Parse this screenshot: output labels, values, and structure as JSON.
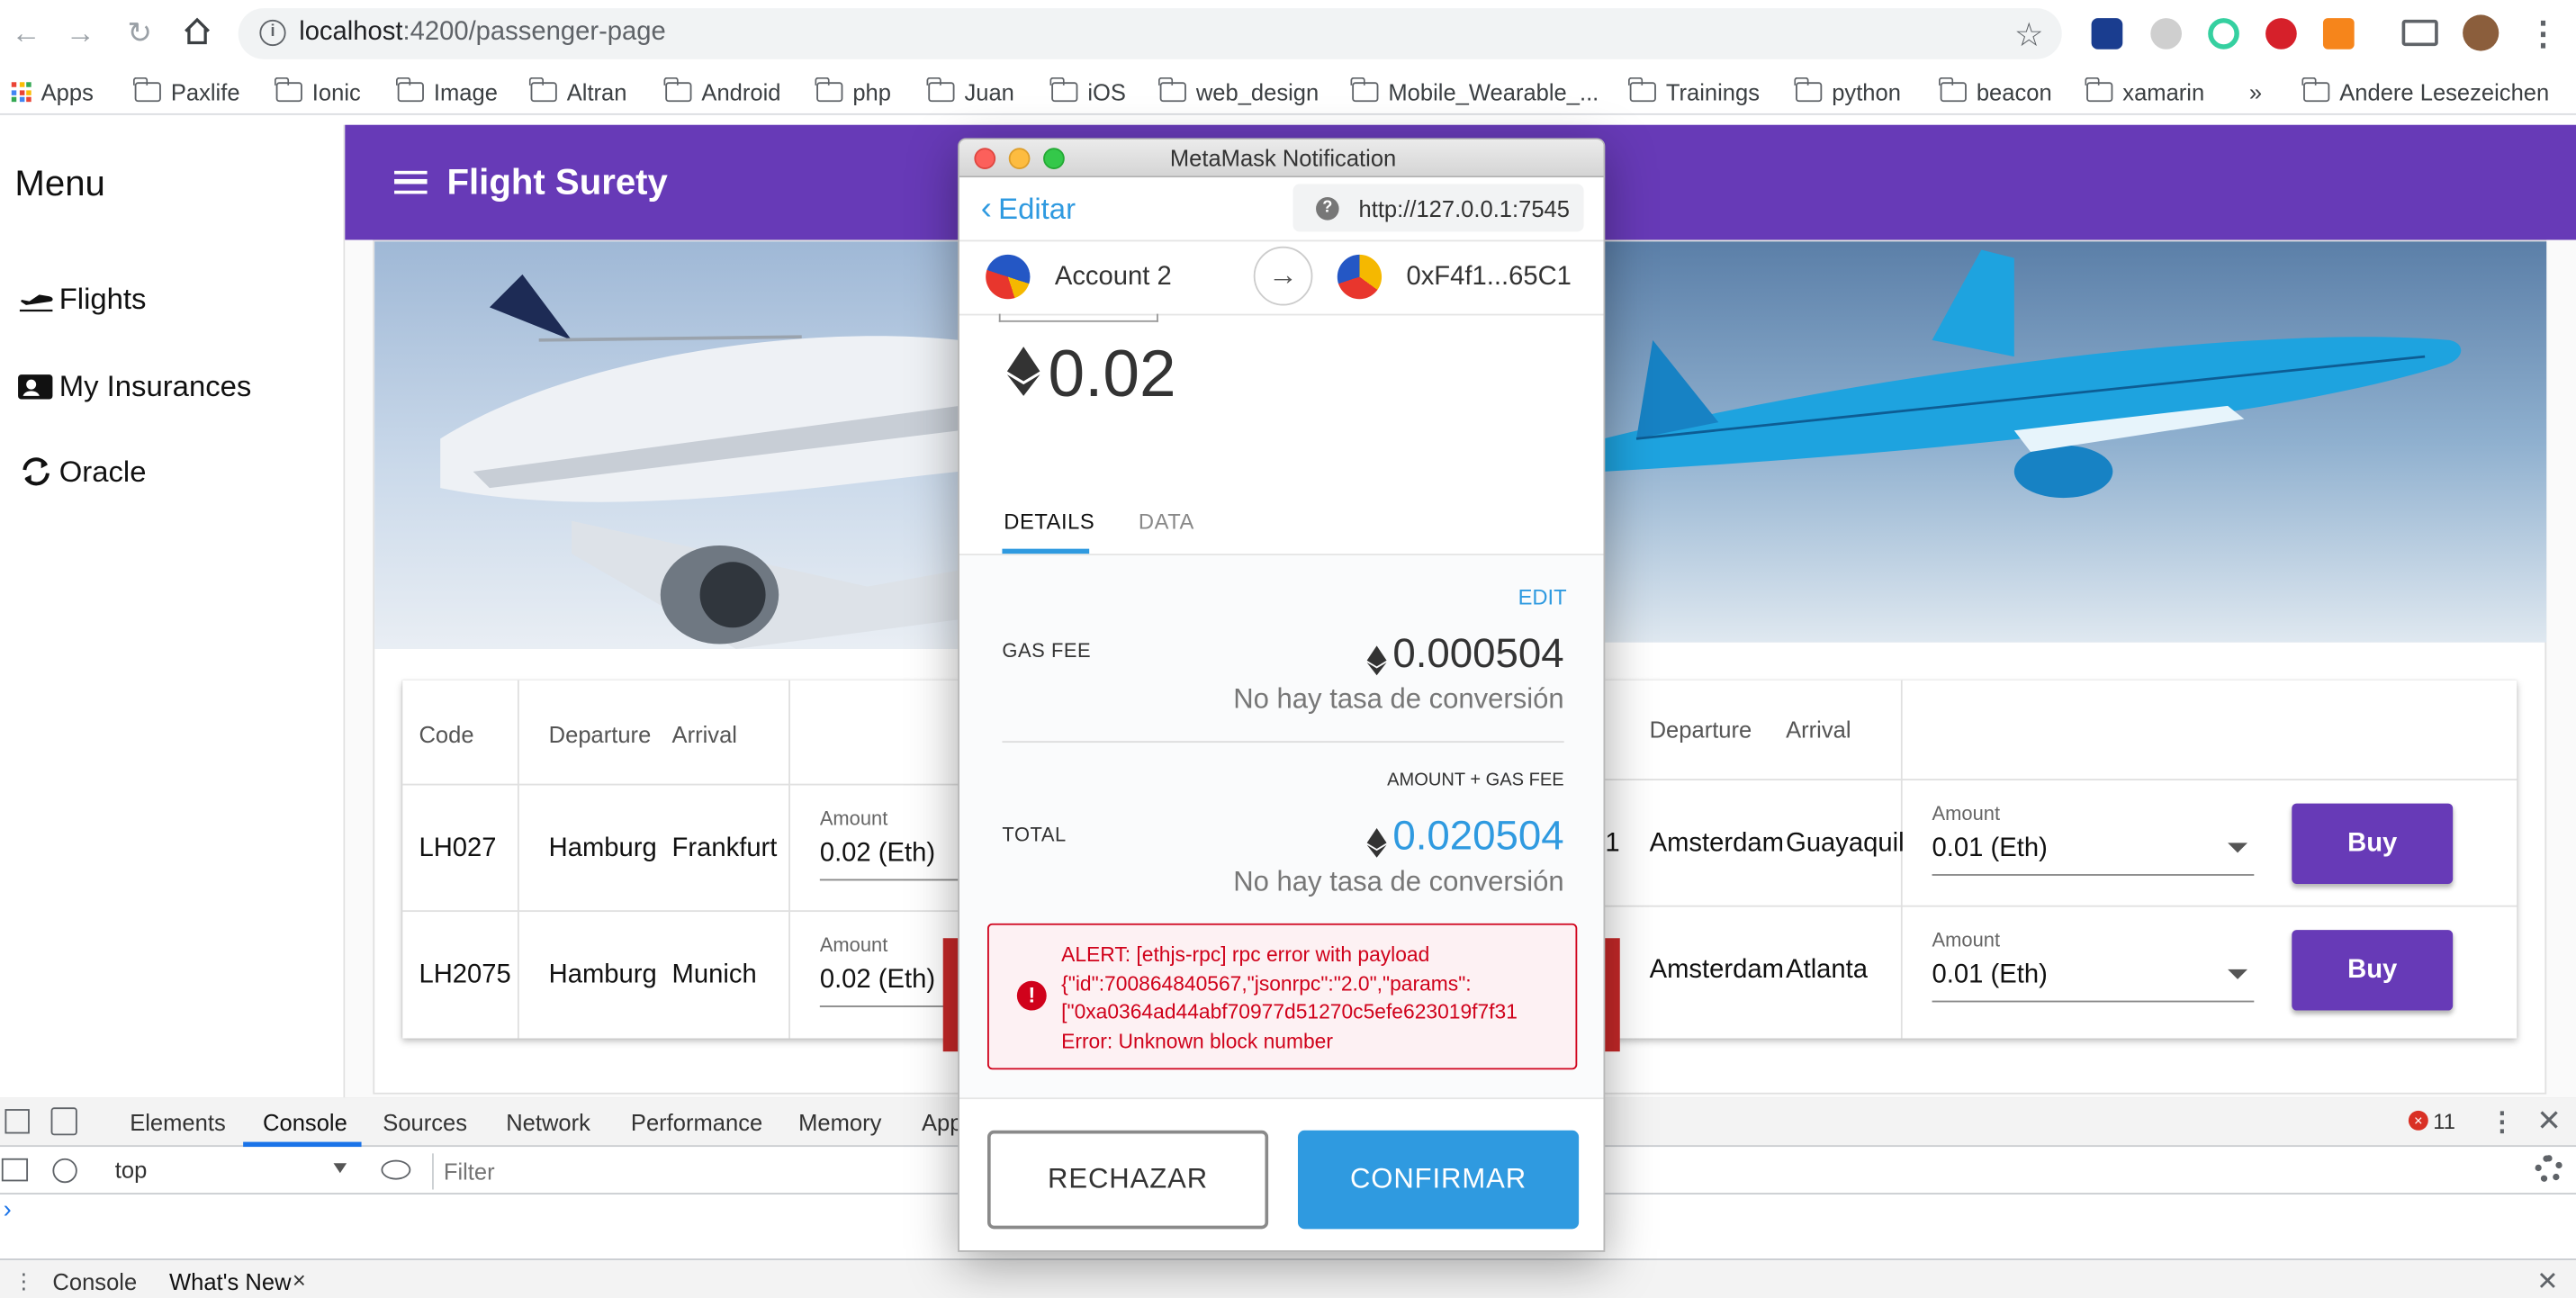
{
  "browser": {
    "url_host": "localhost",
    "url_rest": ":4200/passenger-page",
    "bookmarks": [
      "Apps",
      "Paxlife",
      "Ionic",
      "Image",
      "Altran",
      "Android",
      "php",
      "Juan",
      "iOS",
      "web_design",
      "Mobile_Wearable_...",
      "Trainings",
      "python",
      "beacon",
      "xamarin"
    ],
    "more": "»",
    "other_bookmarks": "Andere Lesezeichen"
  },
  "app": {
    "menu_title": "Menu",
    "title": "Flight Surety",
    "nav": [
      {
        "label": "Flights",
        "icon": "plane-icon"
      },
      {
        "label": "My Insurances",
        "icon": "badge-icon"
      },
      {
        "label": "Oracle",
        "icon": "sync-icon"
      }
    ]
  },
  "table_left": {
    "headers": {
      "code": "Code",
      "departure": "Departure",
      "arrival": "Arrival"
    },
    "rows": [
      {
        "code": "LH027",
        "departure": "Hamburg",
        "arrival": "Frankfurt",
        "amount_label": "Amount",
        "amount": "0.02 (Eth)"
      },
      {
        "code": "LH2075",
        "departure": "Hamburg",
        "arrival": "Munich",
        "amount_label": "Amount",
        "amount": "0.02 (Eth)"
      }
    ]
  },
  "table_right": {
    "headers": {
      "departure": "Departure",
      "arrival": "Arrival"
    },
    "rows": [
      {
        "code_fragment": "1",
        "departure": "Amsterdam",
        "arrival": "Guayaquil",
        "amount_label": "Amount",
        "amount": "0.01 (Eth)",
        "buy": "Buy"
      },
      {
        "code_fragment": "",
        "departure": "Amsterdam",
        "arrival": "Atlanta",
        "amount_label": "Amount",
        "amount": "0.01 (Eth)",
        "buy": "Buy"
      }
    ]
  },
  "devtools": {
    "tabs": [
      "Elements",
      "Console",
      "Sources",
      "Network",
      "Performance",
      "Memory",
      "App"
    ],
    "active_tab": "Console",
    "context": "top",
    "filter_placeholder": "Filter",
    "error_count": "11",
    "prompt": "›",
    "drawer_tabs": [
      "Console",
      "What's New"
    ],
    "drawer_close": "×"
  },
  "metamask": {
    "window_title": "MetaMask Notification",
    "back_label": "Editar",
    "network_url": "http://127.0.0.1:7545",
    "from_account": "Account 2",
    "to_address": "0xF4f1...65C1",
    "amount": "0.02",
    "tabs": [
      "DETAILS",
      "DATA"
    ],
    "edit_link": "EDIT",
    "gas_fee_label": "GAS FEE",
    "gas_fee_value": "0.000504",
    "no_conversion": "No hay tasa de conversión",
    "amount_gas_label": "AMOUNT + GAS FEE",
    "total_label": "TOTAL",
    "total_value": "0.020504",
    "alert_lines": [
      "ALERT: [ethjs-rpc] rpc error with payload",
      "{\"id\":700864840567,\"jsonrpc\":\"2.0\",\"params\":",
      "[\"0xa0364ad44abf70977d51270c5efe623019f7f31",
      "Error: Unknown block number"
    ],
    "reject_label": "RECHAZAR",
    "confirm_label": "CONFIRMAR",
    "colors": {
      "accent": "#2f9ae0",
      "error": "#d0021b",
      "error_bg": "#fdf1f3"
    }
  }
}
